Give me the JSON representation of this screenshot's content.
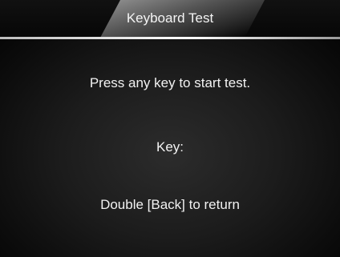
{
  "window": {
    "title": "Keyboard Test"
  },
  "main": {
    "prompt": "Press any key to start test.",
    "key_label": "Key:",
    "return_hint": "Double [Back] to return"
  },
  "colors": {
    "background": "#1c1c1c",
    "text": "#f2f2f2",
    "divider": "#ffffff"
  }
}
